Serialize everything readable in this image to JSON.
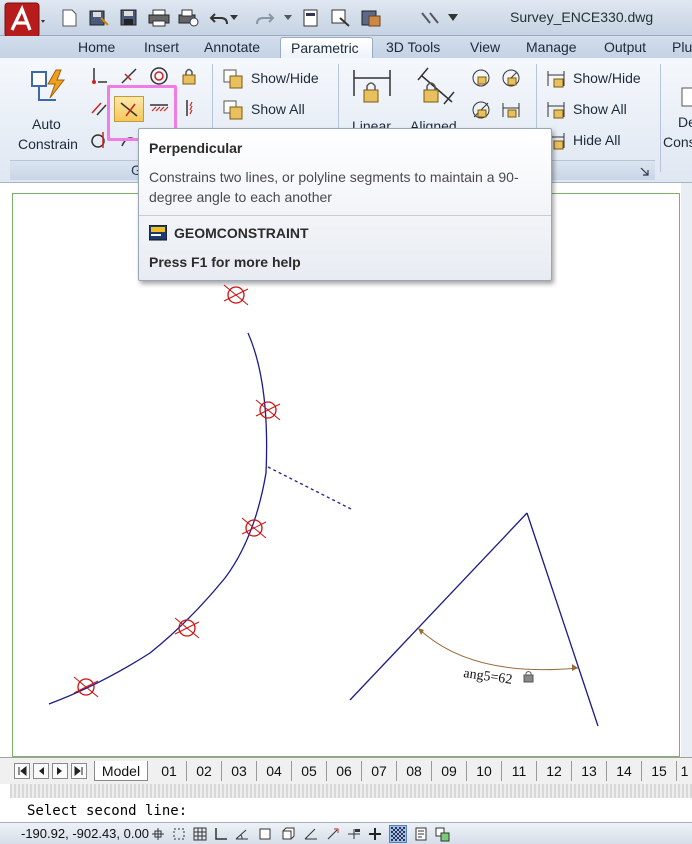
{
  "title_bar": {
    "document_title": "Survey_ENCE330.dwg",
    "quick_access_icons": [
      "new-icon",
      "save-as-icon",
      "save-icon",
      "print-icon",
      "plot-preview-icon",
      "undo-icon",
      "undo-dropdown-icon",
      "redo-icon",
      "redo-dropdown-icon",
      "properties-icon",
      "block-editor-icon",
      "publish-icon",
      "workspace-icon",
      "qat-dropdown-icon"
    ]
  },
  "tabs": [
    {
      "label": "Home"
    },
    {
      "label": "Insert"
    },
    {
      "label": "Annotate"
    },
    {
      "label": "Parametric",
      "active": true
    },
    {
      "label": "3D Tools"
    },
    {
      "label": "View"
    },
    {
      "label": "Manage"
    },
    {
      "label": "Output"
    },
    {
      "label": "Plu"
    }
  ],
  "ribbon": {
    "auto_constrain": {
      "line1": "Auto",
      "line2": "Constrain"
    },
    "geometric_panel_title": "G",
    "geometric": {
      "show_hide": "Show/Hide",
      "show_all": "Show All"
    },
    "dimensional": {
      "linear": "Linear",
      "aligned": "Aligned",
      "show_hide": "Show/Hide",
      "show_all": "Show All",
      "hide_all": "Hide All"
    },
    "manage": {
      "line1": "De",
      "line2": "Cons"
    }
  },
  "tooltip": {
    "title": "Perpendicular",
    "description": "Constrains two lines, or polyline segments to maintain a 90-degree angle to each another",
    "command": "GEOMCONSTRAINT",
    "help": "Press F1 for more help"
  },
  "drawing": {
    "annotation": "ang5=62"
  },
  "layout_tabs": [
    "Model",
    "01",
    "02",
    "03",
    "04",
    "05",
    "06",
    "07",
    "08",
    "09",
    "10",
    "11",
    "12",
    "13",
    "14",
    "15",
    "1"
  ],
  "command_line": {
    "prompt": "Select second line:"
  },
  "status_bar": {
    "coords": "-190.92, -902.43, 0.00"
  },
  "colors": {
    "highlight": "#ee7ee6",
    "curve": "#1a1a8c",
    "constraint_marker": "#cc1111",
    "dimension": "#9a6a3a",
    "viewport_border": "#7eb06a"
  }
}
